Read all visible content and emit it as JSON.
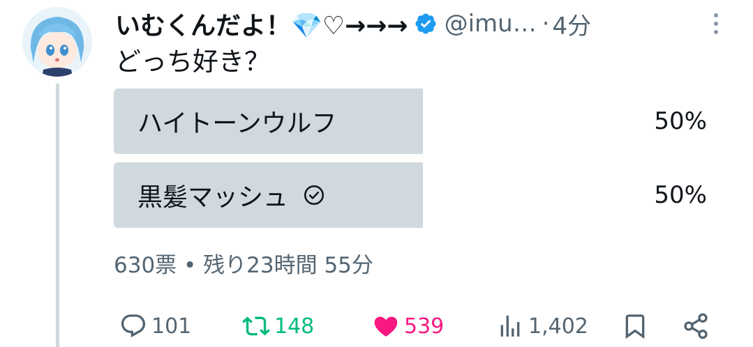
{
  "tweet": {
    "author": {
      "display_name": "いむくんだよ！💎♡→→→",
      "handle": "@imu…",
      "verified": true,
      "separator": "·",
      "time_ago": "4分"
    },
    "text": "どっち好き？",
    "poll": {
      "options": [
        {
          "label": "ハイトーンウルフ",
          "percent": "50%",
          "fraction": 0.5,
          "selected": false
        },
        {
          "label": "黒髪マッシュ",
          "percent": "50%",
          "fraction": 0.5,
          "selected": true
        }
      ],
      "meta": "630票 • 残り23時間 55分"
    },
    "actions": {
      "replies": "101",
      "retweets": "148",
      "likes": "539",
      "views": "1,402"
    }
  },
  "colors": {
    "verified_blue": "#1d9bf0",
    "poll_fill": "#cfd9de",
    "retweet_green": "#00ba7c",
    "like_pink": "#f91880",
    "muted_gray": "#536471"
  },
  "icons": [
    "avatar",
    "verified-badge-icon",
    "more-options-icon",
    "check-circle-icon",
    "reply-icon",
    "retweet-icon",
    "heart-icon",
    "views-icon",
    "bookmark-icon",
    "share-icon"
  ]
}
